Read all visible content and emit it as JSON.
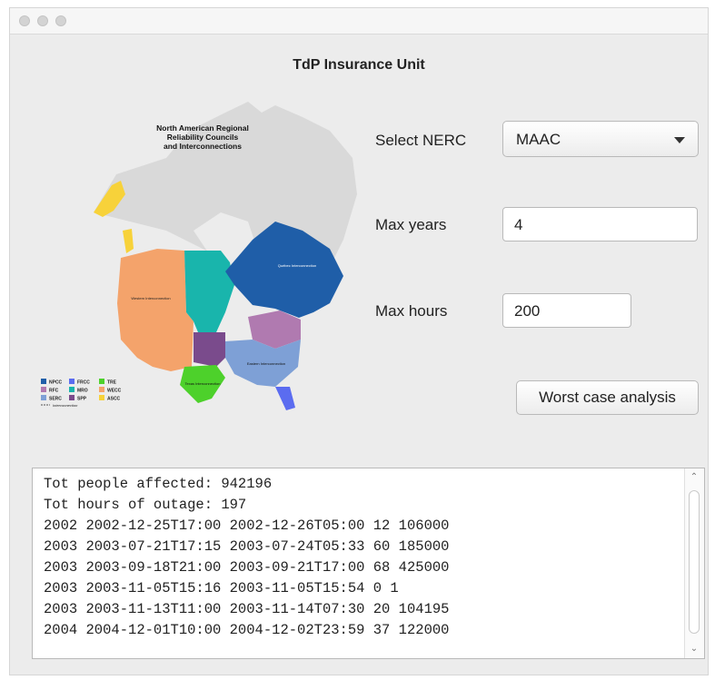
{
  "app": {
    "title": "TdP Insurance Unit"
  },
  "map": {
    "title_lines": [
      "North American Regional",
      "Reliability Councils",
      "and Interconnections"
    ],
    "region_labels": [
      "Western Interconnection",
      "Québec Interconnection",
      "Eastern Interconnection",
      "Texas Interconnection"
    ],
    "legend": [
      {
        "code": "NPCC",
        "color": "#1f5ea8"
      },
      {
        "code": "FRCC",
        "color": "#5b6cf0"
      },
      {
        "code": "TRE",
        "color": "#4dd12b"
      },
      {
        "code": "RFC",
        "color": "#b07ab0"
      },
      {
        "code": "MRO",
        "color": "#19b5ac"
      },
      {
        "code": "WECC",
        "color": "#f4a36b"
      },
      {
        "code": "SERC",
        "color": "#7ea0d6"
      },
      {
        "code": "SPP",
        "color": "#7a4b8c"
      },
      {
        "code": "ASCC",
        "color": "#f7d23a"
      }
    ],
    "legend_note": "Interconnection"
  },
  "form": {
    "nerc_label": "Select NERC",
    "nerc_value": "MAAC",
    "years_label": "Max years",
    "years_value": "4",
    "hours_label": "Max hours",
    "hours_value": "200",
    "analyze_label": "Worst case analysis"
  },
  "output": {
    "lines": [
      "Tot people affected: 942196",
      "Tot hours of outage: 197",
      "2002 2002-12-25T17:00 2002-12-26T05:00 12 106000",
      "2003 2003-07-21T17:15 2003-07-24T05:33 60 185000",
      "2003 2003-09-18T21:00 2003-09-21T17:00 68 425000",
      "2003 2003-11-05T15:16 2003-11-05T15:54 0 1",
      "2003 2003-11-13T11:00 2003-11-14T07:30 20 104195",
      "2004 2004-12-01T10:00 2004-12-02T23:59 37 122000"
    ]
  },
  "icons": {
    "dropdown": "chevron-down-icon",
    "scroll_up": "scroll-up-icon",
    "scroll_down": "scroll-down-icon"
  }
}
